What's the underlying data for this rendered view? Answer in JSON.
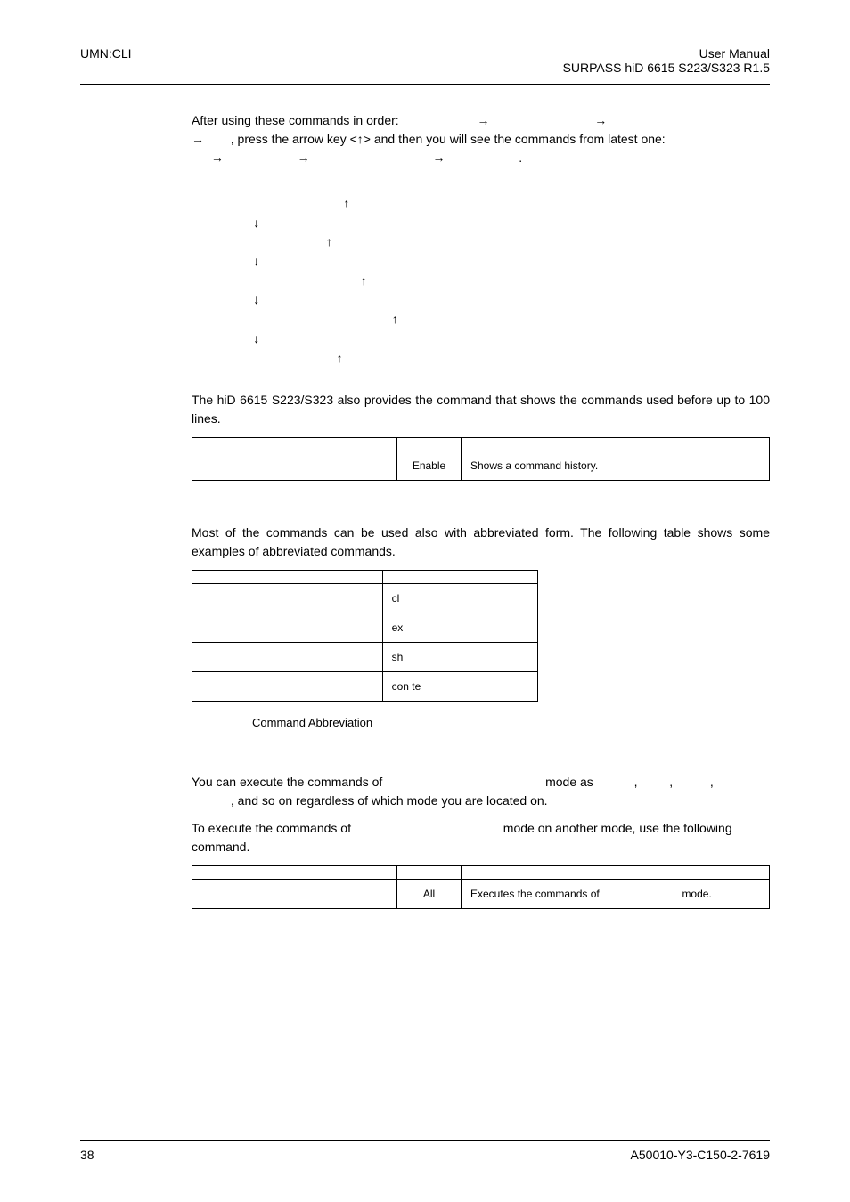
{
  "header": {
    "left": "UMN:CLI",
    "right1": "User Manual",
    "right2": "SURPASS hiD 6615 S223/S323 R1.5"
  },
  "para1a": "After using these commands in order:",
  "para1b": "→",
  "para1c": "→",
  "para1d": "→",
  "para1e": ", press the arrow key <↑> and then you will see the commands from latest one:",
  "para1f": "→",
  "para1g": "→",
  "para1h": "→",
  "para1i": ".",
  "arrows": "                                 ↑\n       ↓\n                            ↑\n       ↓\n                                      ↑\n       ↓\n                                               ↑\n       ↓\n                               ↑",
  "para2": "The hiD 6615 S223/S323 also provides the command that shows the commands used before up to 100 lines.",
  "t1": {
    "h2": "",
    "h3": "",
    "r1c2": "Enable",
    "r1c3": "Shows a command history."
  },
  "para3": "Most of the commands can be used also with abbreviated form. The following table shows some examples of abbreviated commands.",
  "t2": {
    "r1": "cl",
    "r2": "ex",
    "r3": "sh",
    "r4": "con te"
  },
  "caption2": "Command Abbreviation",
  "para4a": "You can execute the commands of",
  "para4b": "mode as",
  "para4c": ",",
  "para4d": ",",
  "para4e": ",",
  "para4f": ", and so on regardless of which mode you are located on.",
  "para5a": "To execute the commands of",
  "para5b": "mode on another mode, use the following command.",
  "t3": {
    "r1c2": "All",
    "r1c3a": "Executes the commands of",
    "r1c3b": "mode."
  },
  "footer": {
    "left": "38",
    "right": "A50010-Y3-C150-2-7619"
  }
}
